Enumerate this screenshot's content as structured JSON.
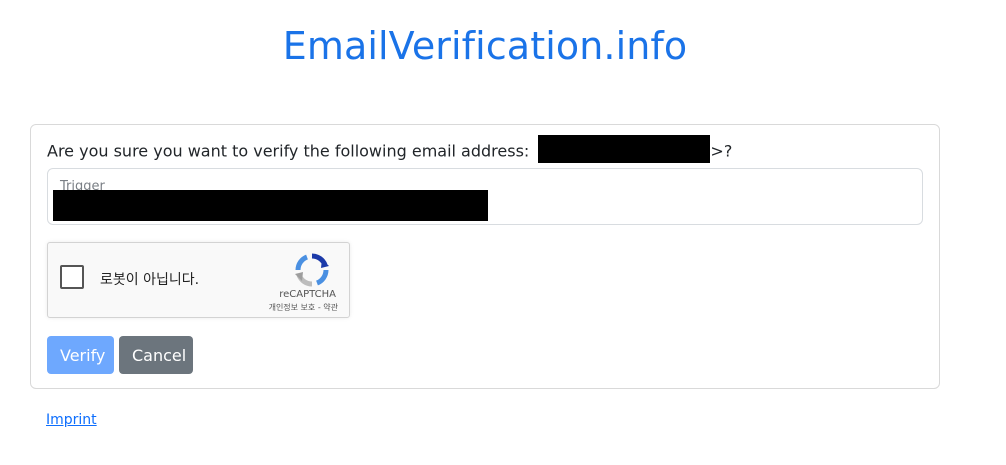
{
  "site": {
    "title": "EmailVerification.info"
  },
  "card": {
    "question_prefix": "Are you sure you want to verify the following email address:",
    "question_suffix": ">?",
    "trigger_label": "Trigger"
  },
  "captcha": {
    "checkbox_label": "로봇이 아닙니다.",
    "brand": "reCAPTCHA",
    "privacy_link": "개인정보 보호",
    "separator": "-",
    "terms_link": "약관",
    "icon": "recaptcha-icon"
  },
  "actions": {
    "verify_label": "Verify",
    "cancel_label": "Cancel"
  },
  "footer": {
    "imprint_label": "Imprint"
  },
  "colors": {
    "title": "#1a73e8",
    "verify_button": "#6ea8fe",
    "cancel_button": "#6c757d",
    "link": "#0d6efd"
  }
}
